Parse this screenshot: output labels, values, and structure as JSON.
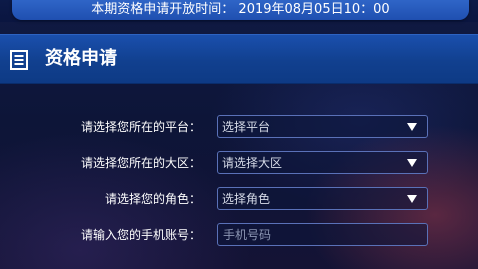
{
  "banner": {
    "text": "本期资格申请开放时间： 2019年08月05日10：00"
  },
  "header": {
    "title": "资格申请",
    "icon": "document-list-icon"
  },
  "form": {
    "platform": {
      "label": "请选择您所在的平台：",
      "value": "选择平台"
    },
    "region": {
      "label": "请选择您所在的大区：",
      "value": "请选择大区"
    },
    "role": {
      "label": "请选择您的角色：",
      "value": "选择角色"
    },
    "phone": {
      "label": "请输入您的手机账号：",
      "placeholder": "手机号码"
    }
  },
  "colors": {
    "banner_blue": "#2f65c7",
    "header_blue": "#11408f",
    "field_border": "#5a71b8",
    "text_white": "#ffffff"
  }
}
